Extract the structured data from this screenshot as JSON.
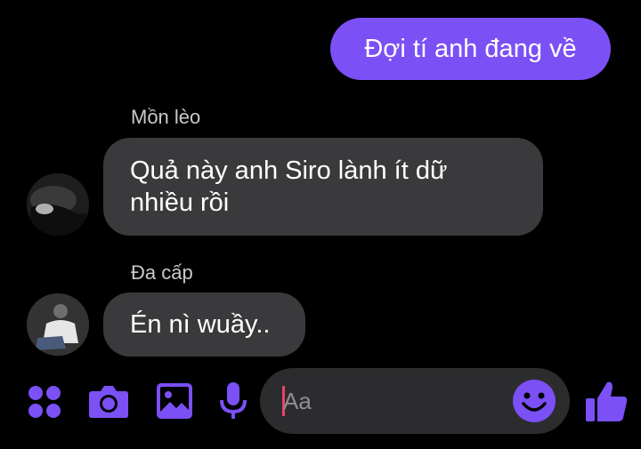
{
  "theme": {
    "accent": "#7b50f5",
    "background": "#000000",
    "incoming_bubble": "#3a3a3c",
    "composer_bg": "#2c2c2e",
    "caret": "#e8436a"
  },
  "messages": [
    {
      "direction": "outgoing",
      "text": "Đợi tí anh đang về"
    },
    {
      "direction": "incoming",
      "sender": "Mồn lèo",
      "lines": [
        "Quả này anh Siro lành ít dữ",
        "nhiều rồi"
      ],
      "avatar_icon": "user-avatar-photo"
    },
    {
      "direction": "incoming",
      "sender": "Đa cấp",
      "text": "Én nì wuầy..",
      "avatar_icon": "user-avatar-photo"
    }
  ],
  "toolbar": {
    "icons": [
      "more-apps-icon",
      "camera-icon",
      "gallery-icon",
      "microphone-icon"
    ],
    "composer_placeholder": "Aa",
    "emoji_icon": "smiley-icon",
    "send_icon": "thumbs-up-icon"
  }
}
